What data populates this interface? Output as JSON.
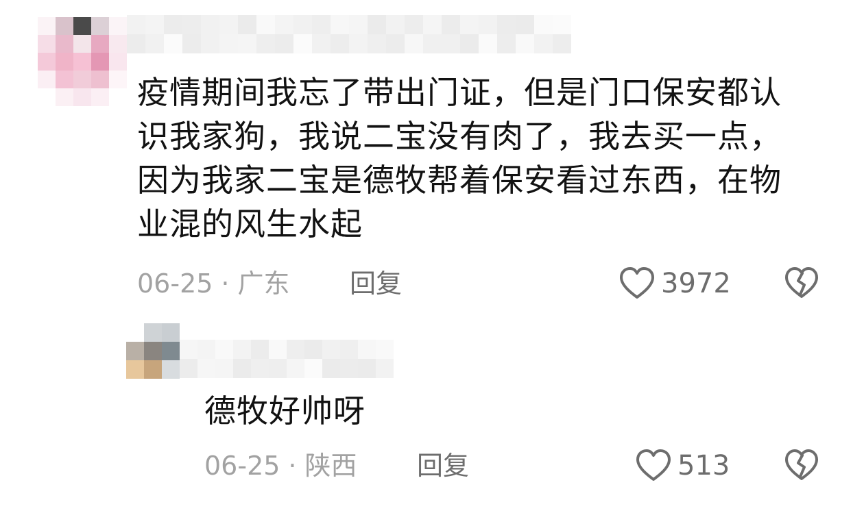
{
  "comments": [
    {
      "text_lines": [
        "疫情期间我忘了带出门证，但是门口保安都认",
        "识我家狗，我说二宝没有肉了，我去买一点，",
        "因为我家二宝是德牧帮着保安看过东西，在物",
        "业混的风生水起"
      ],
      "date": "06-25",
      "separator": "·",
      "location": "广东",
      "reply_label": "回复",
      "like_count": "3972",
      "like_icon": "heart-outline-icon",
      "dislike_icon": "broken-heart-icon"
    },
    {
      "text_lines": [
        "德牧好帅呀"
      ],
      "date": "06-25",
      "separator": "·",
      "location": "陕西",
      "reply_label": "回复",
      "like_count": "513",
      "like_icon": "heart-outline-icon",
      "dislike_icon": "broken-heart-icon"
    }
  ],
  "colors": {
    "text": "#121212",
    "meta": "#a2a2a2",
    "action": "#6d6d6d",
    "background": "#ffffff"
  }
}
